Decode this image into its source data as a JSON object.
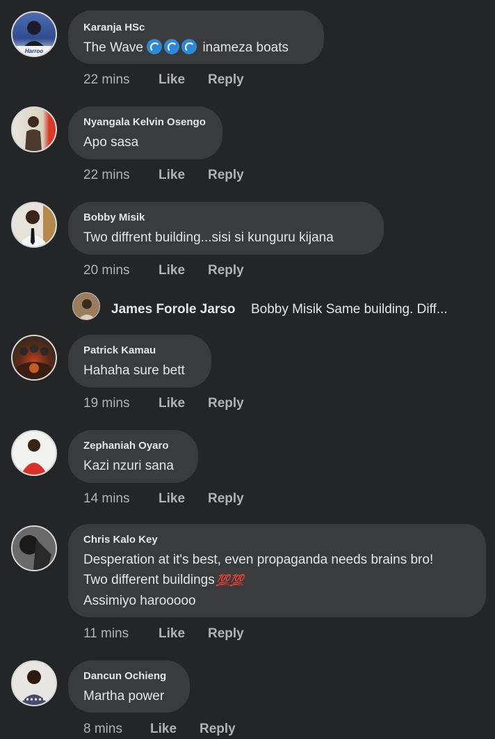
{
  "comments": [
    {
      "author": "Karanja HSc",
      "text_before": "The Wave",
      "text_after": "inameza boats",
      "time": "22 mins",
      "like": "Like",
      "reply": "Reply"
    },
    {
      "author": "Nyangala Kelvin Osengo",
      "text": "Apo sasa",
      "time": "22 mins",
      "like": "Like",
      "reply": "Reply"
    },
    {
      "author": "Bobby Misik",
      "text": "Two diffrent building...sisi si kunguru kijana",
      "time": "20 mins",
      "like": "Like",
      "reply": "Reply"
    },
    {
      "author": "Patrick Kamau",
      "text": "Hahaha sure bett",
      "time": "19 mins",
      "like": "Like",
      "reply": "Reply"
    },
    {
      "author": "Zephaniah Oyaro",
      "text": "Kazi nzuri sana",
      "time": "14 mins",
      "like": "Like",
      "reply": "Reply"
    },
    {
      "author": "Chris Kalo Key",
      "line1": "Desperation at it's  best, even propaganda needs brains bro!",
      "line2": "Two different buildings",
      "emoji": "💯💯",
      "line3": "Assimiyo harooooo",
      "time": "11 mins",
      "like": "Like",
      "reply": "Reply"
    },
    {
      "author": "Dancun Ochieng",
      "text": "Martha power",
      "time": "8 mins",
      "like": "Like",
      "reply": "Reply"
    }
  ],
  "nested_reply": {
    "author": "James Forole Jarso",
    "snippet": "Bobby Misik Same building. Diff..."
  },
  "avatar_text": {
    "karanja": "Harroo"
  },
  "colors": {
    "background": "#242526",
    "bubble": "#3a3b3c",
    "text": "#e4e6eb",
    "meta": "#b0b3b8"
  }
}
